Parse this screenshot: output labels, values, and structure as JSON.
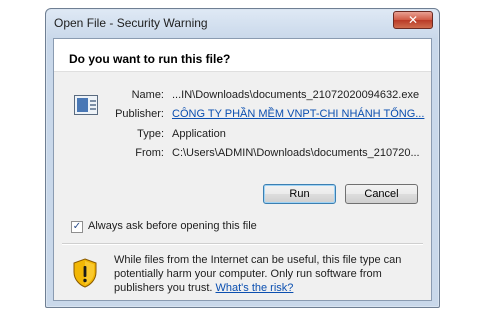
{
  "window": {
    "title": "Open File - Security Warning",
    "close_glyph": "✕"
  },
  "dialog": {
    "question": "Do you want to run this file?",
    "file_icon": "executable-file-icon",
    "fields": {
      "name_label": "Name:",
      "name_value": "...IN\\Downloads\\documents_21072020094632.exe",
      "publisher_label": "Publisher:",
      "publisher_value": "CÔNG TY PHẦN MỀM VNPT-CHI NHÁNH TỔNG...",
      "type_label": "Type:",
      "type_value": "Application",
      "from_label": "From:",
      "from_value": "C:\\Users\\ADMIN\\Downloads\\documents_210720..."
    },
    "buttons": {
      "run_label": "Run",
      "cancel_label": "Cancel"
    },
    "checkbox": {
      "label": "Always ask before opening this file",
      "checked": true,
      "check_glyph": "✓"
    },
    "warning": {
      "icon": "shield-warning-icon",
      "text": "While files from the Internet can be useful, this file type can potentially harm your computer. Only run software from publishers you trust.",
      "link": "What's the risk?"
    }
  },
  "colors": {
    "link": "#0b4fb0",
    "title_bar": "#c9d8ea",
    "close_button": "#c9452f"
  }
}
